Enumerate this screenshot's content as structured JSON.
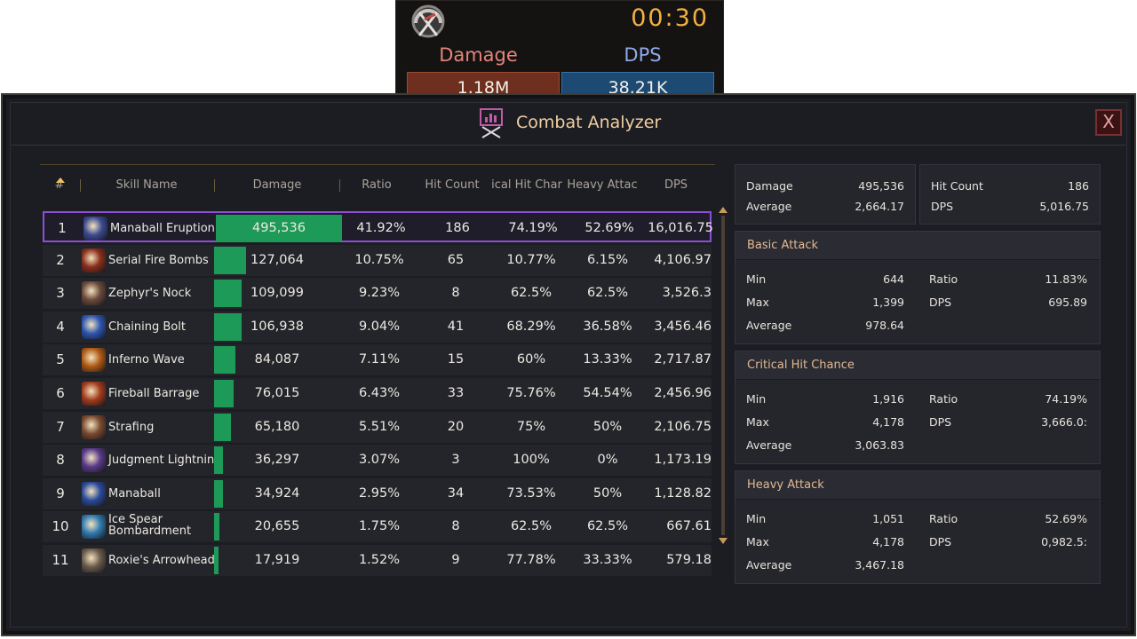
{
  "tracker": {
    "icon": "crossed-swords-gauge-icon",
    "timer": "00:30",
    "damage_label": "Damage",
    "dps_label": "DPS",
    "damage_value": "1.18M",
    "dps_value": "38.21K",
    "damage_color": "#6e2f1e",
    "dps_color": "#1d4a73"
  },
  "window": {
    "title": "Combat Analyzer",
    "title_icon": "combat-analyzer-icon",
    "close_label": "X"
  },
  "table": {
    "headers": {
      "rank": "#",
      "skill_name": "Skill Name",
      "damage": "Damage",
      "ratio": "Ratio",
      "hit_count": "Hit Count",
      "crit": "ical Hit Char",
      "heavy": "Heavy Attac",
      "dps": "DPS"
    },
    "bar_color": "#1e9a58",
    "selected_color": "#8d4fd6",
    "rows": [
      {
        "rank": "1",
        "name": "Manaball Eruption",
        "damage": "495,536",
        "ratio": "41.92%",
        "ratio_value": 0.4192,
        "hits": "186",
        "crit": "74.19%",
        "heavy": "52.69%",
        "dps": "16,016.75",
        "icon": "manaball-eruption-icon",
        "icon_color": "#3b4a8f"
      },
      {
        "rank": "2",
        "name": "Serial Fire Bombs",
        "damage": "127,064",
        "ratio": "10.75%",
        "ratio_value": 0.1075,
        "hits": "65",
        "crit": "10.77%",
        "heavy": "6.15%",
        "dps": "4,106.97",
        "icon": "serial-fire-bombs-icon",
        "icon_color": "#8a2e1a"
      },
      {
        "rank": "3",
        "name": "Zephyr's Nock",
        "damage": "109,099",
        "ratio": "9.23%",
        "ratio_value": 0.0923,
        "hits": "8",
        "crit": "62.5%",
        "heavy": "62.5%",
        "dps": "3,526.3",
        "icon": "zephyrs-nock-icon",
        "icon_color": "#6b4a3a"
      },
      {
        "rank": "4",
        "name": "Chaining Bolt",
        "damage": "106,938",
        "ratio": "9.04%",
        "ratio_value": 0.0904,
        "hits": "41",
        "crit": "68.29%",
        "heavy": "36.58%",
        "dps": "3,456.46",
        "icon": "chaining-bolt-icon",
        "icon_color": "#2d56b0"
      },
      {
        "rank": "5",
        "name": "Inferno Wave",
        "damage": "84,087",
        "ratio": "7.11%",
        "ratio_value": 0.0711,
        "hits": "15",
        "crit": "60%",
        "heavy": "13.33%",
        "dps": "2,717.87",
        "icon": "inferno-wave-icon",
        "icon_color": "#b05a14"
      },
      {
        "rank": "6",
        "name": "Fireball Barrage",
        "damage": "76,015",
        "ratio": "6.43%",
        "ratio_value": 0.0643,
        "hits": "33",
        "crit": "75.76%",
        "heavy": "54.54%",
        "dps": "2,456.96",
        "icon": "fireball-barrage-icon",
        "icon_color": "#a33b1c"
      },
      {
        "rank": "7",
        "name": "Strafing",
        "damage": "65,180",
        "ratio": "5.51%",
        "ratio_value": 0.0551,
        "hits": "20",
        "crit": "75%",
        "heavy": "50%",
        "dps": "2,106.75",
        "icon": "strafing-icon",
        "icon_color": "#7a4a30"
      },
      {
        "rank": "8",
        "name": "Judgment Lightning",
        "damage": "36,297",
        "ratio": "3.07%",
        "ratio_value": 0.0307,
        "hits": "3",
        "crit": "100%",
        "heavy": "0%",
        "dps": "1,173.19",
        "icon": "judgment-lightning-icon",
        "icon_color": "#5a3a8a"
      },
      {
        "rank": "9",
        "name": "Manaball",
        "damage": "34,924",
        "ratio": "2.95%",
        "ratio_value": 0.0295,
        "hits": "34",
        "crit": "73.53%",
        "heavy": "50%",
        "dps": "1,128.82",
        "icon": "manaball-icon",
        "icon_color": "#2a4a9a"
      },
      {
        "rank": "10",
        "name": "Ice Spear Bombardment",
        "damage": "20,655",
        "ratio": "1.75%",
        "ratio_value": 0.0175,
        "hits": "8",
        "crit": "62.5%",
        "heavy": "62.5%",
        "dps": "667.61",
        "icon": "ice-spear-bombardment-icon",
        "icon_color": "#2f7ab0"
      },
      {
        "rank": "11",
        "name": "Roxie's Arrowhead",
        "damage": "17,919",
        "ratio": "1.52%",
        "ratio_value": 0.0152,
        "hits": "9",
        "crit": "77.78%",
        "heavy": "33.33%",
        "dps": "579.18",
        "icon": "roxies-arrowhead-icon",
        "icon_color": "#6a5a4a"
      }
    ]
  },
  "summary": {
    "damage_label": "Damage",
    "damage_value": "495,536",
    "average_label": "Average",
    "average_value": "2,664.17",
    "hit_count_label": "Hit Count",
    "hit_count_value": "186",
    "dps_label": "DPS",
    "dps_value": "5,016.75"
  },
  "basic_attack": {
    "title": "Basic Attack",
    "min_label": "Min",
    "min_value": "644",
    "max_label": "Max",
    "max_value": "1,399",
    "avg_label": "Average",
    "avg_value": "978.64",
    "ratio_label": "Ratio",
    "ratio_value": "11.83%",
    "dps_label": "DPS",
    "dps_value": "695.89"
  },
  "critical_hit": {
    "title": "Critical Hit Chance",
    "min_label": "Min",
    "min_value": "1,916",
    "max_label": "Max",
    "max_value": "4,178",
    "avg_label": "Average",
    "avg_value": "3,063.83",
    "ratio_label": "Ratio",
    "ratio_value": "74.19%",
    "dps_label": "DPS",
    "dps_value": "3,666.0:"
  },
  "heavy_attack": {
    "title": "Heavy Attack",
    "min_label": "Min",
    "min_value": "1,051",
    "max_label": "Max",
    "max_value": "4,178",
    "avg_label": "Average",
    "avg_value": "3,467.18",
    "ratio_label": "Ratio",
    "ratio_value": "52.69%",
    "dps_label": "DPS",
    "dps_value": "0,982.5:"
  }
}
